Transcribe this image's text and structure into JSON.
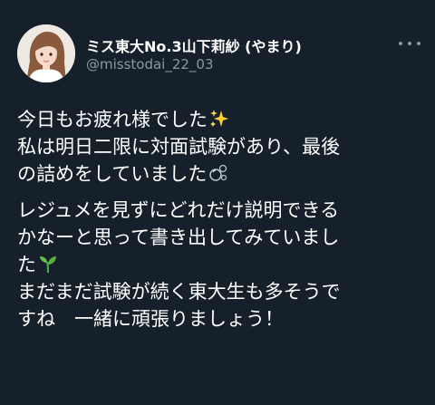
{
  "tweet": {
    "display_name": "ミス東大No.3山下莉紗 (やまり)",
    "handle": "@misstodai_22_03",
    "more_icon": "more-horizontal-icon",
    "avatar_icon": "profile-avatar",
    "paragraphs": [
      {
        "lines": [
          {
            "text": "今日もお疲れ様でした",
            "emoji": "sparkles-emoji"
          },
          {
            "text": "私は明日二限に対面試験があり、最後"
          },
          {
            "text": "の詰めをしていました",
            "emoji": "bubbles-emoji"
          }
        ]
      },
      {
        "lines": [
          {
            "text": "レジュメを見ずにどれだけ説明できる"
          },
          {
            "text": "かなーと思って書き出してみていまし"
          },
          {
            "text": "た",
            "emoji": "seedling-emoji"
          },
          {
            "text": "まだまだ試験が続く東大生も多そうで"
          },
          {
            "text": "すね　一緒に頑張りましょう！"
          }
        ]
      }
    ]
  },
  "colors": {
    "background": "#15202b",
    "text_primary": "#ffffff",
    "text_secondary": "#8b98a5"
  }
}
